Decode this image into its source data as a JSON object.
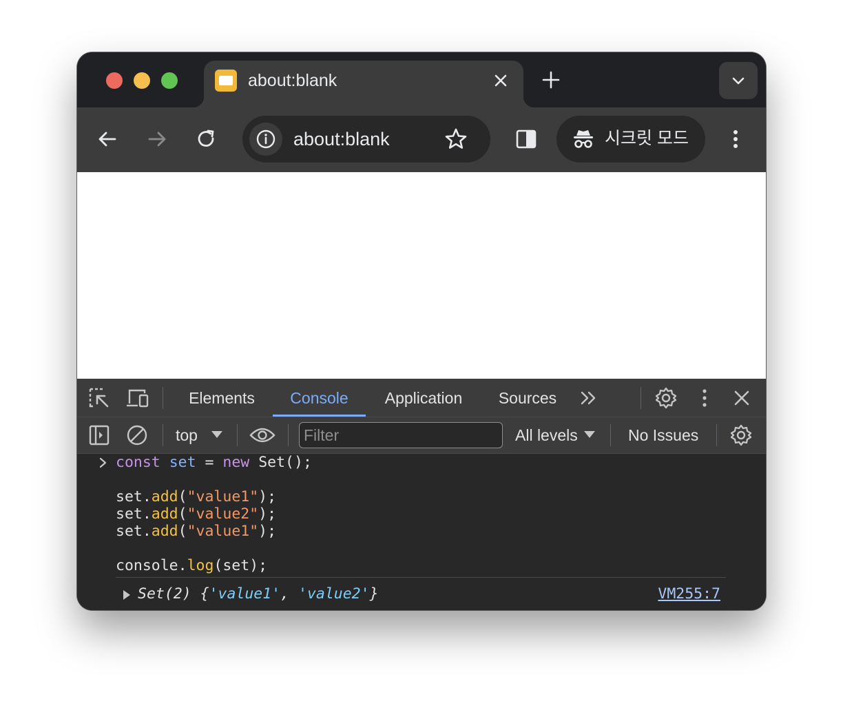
{
  "window": {
    "tab": {
      "title": "about:blank",
      "favicon": "page-favicon-icon"
    },
    "new_tab_icon": "plus-icon",
    "tab_search_icon": "chevron-down-icon"
  },
  "toolbar": {
    "back_icon": "arrow-left-icon",
    "forward_icon": "arrow-right-icon",
    "reload_icon": "reload-icon",
    "omnibox": {
      "url": "about:blank",
      "info_icon": "info-icon",
      "bookmark_icon": "star-icon"
    },
    "side_panel_icon": "side-panel-icon",
    "incognito": {
      "label": "시크릿 모드",
      "icon": "incognito-icon"
    },
    "menu_icon": "kebab-menu-icon"
  },
  "devtools": {
    "tabs": [
      {
        "label": "Elements",
        "active": false
      },
      {
        "label": "Console",
        "active": true
      },
      {
        "label": "Application",
        "active": false
      },
      {
        "label": "Sources",
        "active": false
      }
    ],
    "more_tabs_icon": "double-chevron-icon",
    "console_toolbar": {
      "context": "top",
      "filter_placeholder": "Filter",
      "levels": "All levels",
      "issues": "No Issues"
    },
    "console": {
      "input_lines": [
        "const set = new Set();",
        "",
        "set.add(\"value1\");",
        "set.add(\"value2\");",
        "set.add(\"value1\");",
        "",
        "console.log(set);"
      ],
      "output": {
        "text": "Set(2) {'value1', 'value2'}",
        "prefix": "Set(2) {",
        "item1": "'value1'",
        "sep": ", ",
        "item2": "'value2'",
        "suffix": "}",
        "source": "VM255:7"
      }
    },
    "colors": {
      "accent": "#7cacf8",
      "keyword": "#c792ea",
      "variable": "#7fb4ff",
      "function": "#f4c042",
      "string": "#f29766",
      "output_string": "#7fcff8"
    }
  }
}
